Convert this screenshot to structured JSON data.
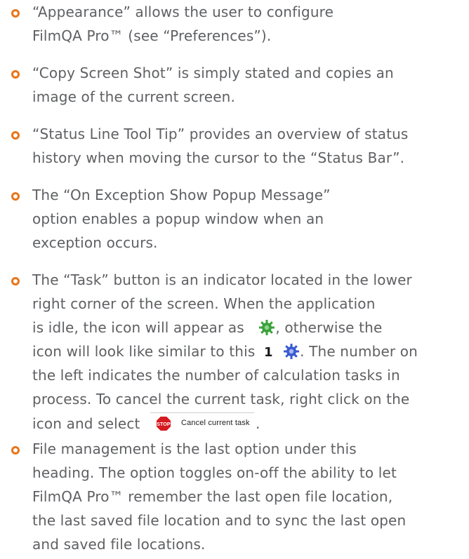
{
  "colors": {
    "bullet": "#e8751a",
    "text": "#5f6063",
    "gear_idle": "#3aa23a",
    "gear_busy": "#3b5bd1",
    "stop_red": "#d71920"
  },
  "items": [
    {
      "lines": [
        "“Appearance” allows the user to configure",
        "FilmQA Pro™ (see “Preferences”)."
      ]
    },
    {
      "lines": [
        "“Copy Screen Shot” is simply stated and copies an",
        "image of the current screen."
      ]
    },
    {
      "lines": [
        "“Status Line Tool Tip” provides an overview of status",
        "history when moving the cursor to the “Status Bar”."
      ]
    },
    {
      "lines": [
        "The “On Exception Show Popup Message”",
        "option enables a popup window when an",
        "exception occurs."
      ]
    },
    {
      "line1": "The “Task” button is an indicator located in the lower",
      "line2": "right corner of the screen. When the application",
      "line3_before": "is idle, the icon will appear as",
      "line3_after": ", otherwise the",
      "line4_before": "icon will look like similar to this",
      "line4_after": ". The number on",
      "task_count": "1",
      "line5": "the left indicates the number of calculation tasks in",
      "line6": "process. To cancel the current task, right click on the",
      "line7_before": "icon and select",
      "line7_after": ".",
      "stop_text": "STOP",
      "cancel_label": "Cancel current task"
    },
    {
      "lines": [
        "File management is the last option under this",
        "heading. The option toggles on-off the ability to let",
        "FilmQA Pro™ remember the last open file location,",
        "the last saved file location and to sync the last open",
        "and saved file locations."
      ]
    }
  ]
}
